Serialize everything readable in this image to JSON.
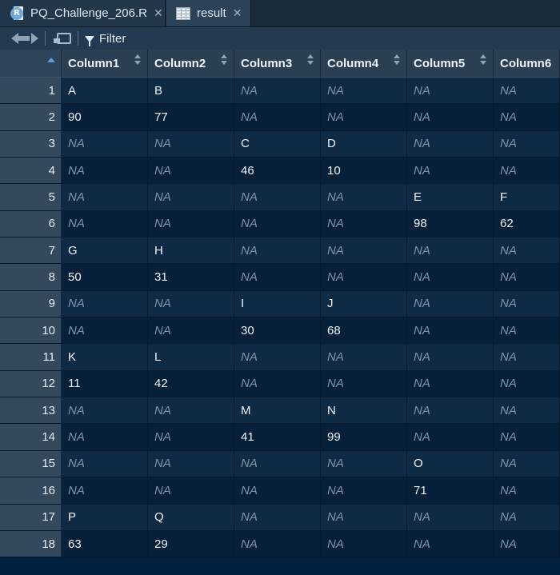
{
  "tabs": [
    {
      "label": "PQ_Challenge_206.R",
      "icon": "r-script-icon"
    },
    {
      "label": "result",
      "icon": "data-grid-icon"
    }
  ],
  "toolbar": {
    "filter_label": "Filter"
  },
  "table": {
    "columns": [
      "Column1",
      "Column2",
      "Column3",
      "Column4",
      "Column5",
      "Column6"
    ],
    "na_text": "NA",
    "rows": [
      {
        "n": "1",
        "cells": [
          "A",
          "B",
          null,
          null,
          null,
          null
        ]
      },
      {
        "n": "2",
        "cells": [
          "90",
          "77",
          null,
          null,
          null,
          null
        ]
      },
      {
        "n": "3",
        "cells": [
          null,
          null,
          "C",
          "D",
          null,
          null
        ]
      },
      {
        "n": "4",
        "cells": [
          null,
          null,
          "46",
          "10",
          null,
          null
        ]
      },
      {
        "n": "5",
        "cells": [
          null,
          null,
          null,
          null,
          "E",
          "F"
        ]
      },
      {
        "n": "6",
        "cells": [
          null,
          null,
          null,
          null,
          "98",
          "62"
        ]
      },
      {
        "n": "7",
        "cells": [
          "G",
          "H",
          null,
          null,
          null,
          null
        ]
      },
      {
        "n": "8",
        "cells": [
          "50",
          "31",
          null,
          null,
          null,
          null
        ]
      },
      {
        "n": "9",
        "cells": [
          null,
          null,
          "I",
          "J",
          null,
          null
        ]
      },
      {
        "n": "10",
        "cells": [
          null,
          null,
          "30",
          "68",
          null,
          null
        ]
      },
      {
        "n": "11",
        "cells": [
          "K",
          "L",
          null,
          null,
          null,
          null
        ]
      },
      {
        "n": "12",
        "cells": [
          "11",
          "42",
          null,
          null,
          null,
          null
        ]
      },
      {
        "n": "13",
        "cells": [
          null,
          null,
          "M",
          "N",
          null,
          null
        ]
      },
      {
        "n": "14",
        "cells": [
          null,
          null,
          "41",
          "99",
          null,
          null
        ]
      },
      {
        "n": "15",
        "cells": [
          null,
          null,
          null,
          null,
          "O",
          null
        ]
      },
      {
        "n": "16",
        "cells": [
          null,
          null,
          null,
          null,
          "71",
          null
        ]
      },
      {
        "n": "17",
        "cells": [
          "P",
          "Q",
          null,
          null,
          null,
          null
        ]
      },
      {
        "n": "18",
        "cells": [
          "63",
          "29",
          null,
          null,
          null,
          null
        ]
      }
    ]
  }
}
